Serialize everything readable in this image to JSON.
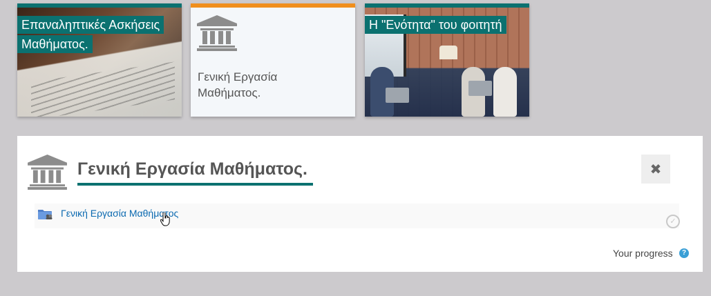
{
  "tiles": [
    {
      "caption_lines": [
        "Επαναληπτικές Ασκήσεις",
        "Μαθήματος."
      ],
      "image": "exam-papers-photo"
    },
    {
      "title": "Γενική Εργασία Μαθήματος.",
      "icon": "institution-icon"
    },
    {
      "caption_lines": [
        "Η \"Ενότητα\" του φοιτητή"
      ],
      "image": "students-with-laptops-photo"
    }
  ],
  "panel": {
    "heading": "Γενική Εργασία Μαθήματος.",
    "icon": "institution-icon",
    "close_label": "✖",
    "activity": {
      "link_text": "Γενική Εργασία Μαθήματος",
      "icon": "folder-icon",
      "completion_icon": "checkmark-circle-icon"
    },
    "progress_label": "Your progress",
    "help_label": "?"
  },
  "colors": {
    "accent_teal": "#0b7170",
    "accent_orange": "#f08f1c",
    "link_blue": "#0a69b0",
    "background": "#cccacd"
  }
}
